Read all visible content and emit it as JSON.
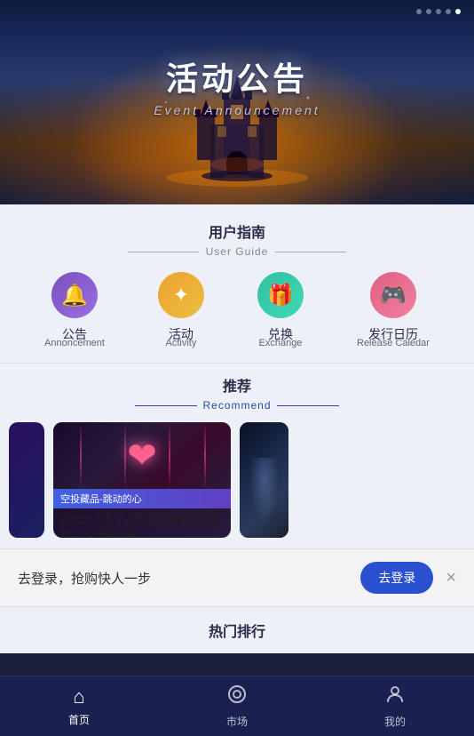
{
  "hero": {
    "title_cn": "活动公告",
    "title_en": "Event Announcement",
    "dots": [
      false,
      false,
      false,
      false,
      true
    ]
  },
  "user_guide": {
    "title_cn": "用户指南",
    "title_en": "User Guide",
    "items": [
      {
        "label_cn": "公告",
        "label_en": "Annoncement",
        "icon": "🔔",
        "style": "icon-announcement"
      },
      {
        "label_cn": "活动",
        "label_en": "Activity",
        "icon": "✦",
        "style": "icon-activity"
      },
      {
        "label_cn": "兑换",
        "label_en": "Exchange",
        "icon": "🎁",
        "style": "icon-exchange"
      },
      {
        "label_cn": "发行日历",
        "label_en": "Release Caledar",
        "icon": "🎮",
        "style": "icon-release"
      }
    ]
  },
  "recommend": {
    "title_cn": "推荐",
    "title_en": "Recommend",
    "cards": [
      {
        "tag": "空投藏品-跳动的心",
        "desc": "这是一个关于人类抵达新世界的传物，人们努力向",
        "image_alt": "heart-nft"
      }
    ]
  },
  "login_banner": {
    "text": "去登录，抢购快人一步",
    "btn_label": "去登录",
    "close_label": "×"
  },
  "hot_rankings": {
    "title_cn": "热门排行"
  },
  "bottom_nav": {
    "items": [
      {
        "label": "首页",
        "icon": "⌂",
        "active": true
      },
      {
        "label": "市场",
        "icon": "◎",
        "active": false
      },
      {
        "label": "我的",
        "icon": "👤",
        "active": false
      }
    ]
  }
}
